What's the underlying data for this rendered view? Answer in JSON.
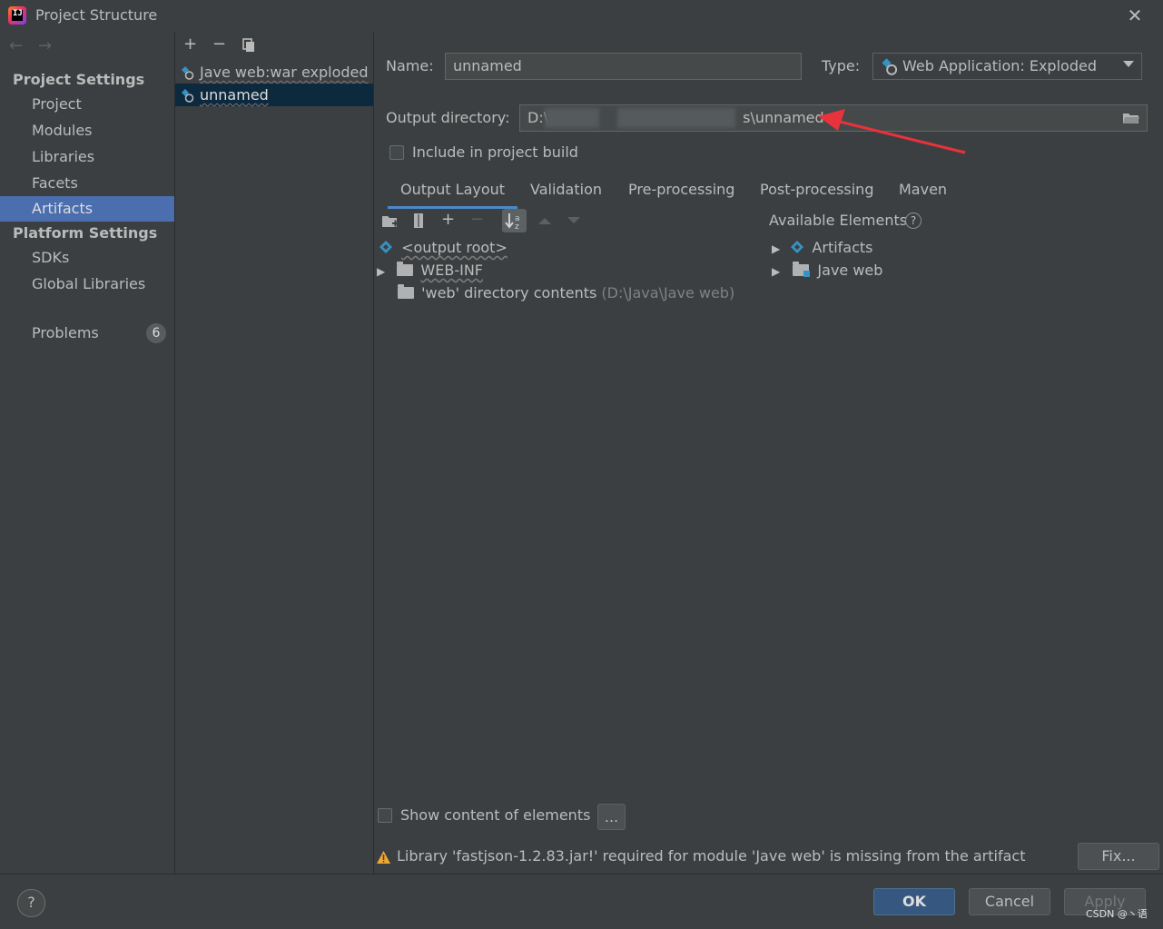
{
  "window": {
    "title": "Project Structure"
  },
  "nav": {
    "project_settings_header": "Project Settings",
    "items_project": [
      "Project",
      "Modules",
      "Libraries",
      "Facets",
      "Artifacts"
    ],
    "platform_settings_header": "Platform Settings",
    "items_platform": [
      "SDKs",
      "Global Libraries"
    ],
    "problems_label": "Problems",
    "problems_count": "6",
    "selected": "Artifacts"
  },
  "artifacts": {
    "items": [
      "Jave web:war exploded",
      "unnamed"
    ],
    "selected": "unnamed"
  },
  "detail": {
    "name_label": "Name:",
    "name_value": "unnamed",
    "type_label": "Type:",
    "type_value": "Web Application: Exploded",
    "output_dir_label": "Output directory:",
    "output_dir_prefix": "D:\\",
    "output_dir_suffix": "s\\unnamed",
    "include_build_label": "Include in project build",
    "include_build_checked": false,
    "tabs": [
      "Output Layout",
      "Validation",
      "Pre-processing",
      "Post-processing",
      "Maven"
    ],
    "active_tab": "Output Layout"
  },
  "output_layout": {
    "tree": [
      {
        "label": "<output root>",
        "icon": "artifact-root-icon",
        "expandable": false
      },
      {
        "label": "WEB-INF",
        "icon": "folder-icon",
        "expandable": true
      },
      {
        "label": "'web' directory contents",
        "path": "(D:\\Java\\Jave web)",
        "icon": "folder-icon",
        "expandable": false
      }
    ]
  },
  "available": {
    "header": "Available Elements",
    "items": [
      {
        "label": "Artifacts",
        "icon": "artifacts-icon"
      },
      {
        "label": "Jave web",
        "icon": "module-folder-icon"
      }
    ]
  },
  "bottom": {
    "show_content_label": "Show content of elements",
    "more_button": "...",
    "warning_text": "Library 'fastjson-1.2.83.jar!' required for module 'Jave web' is missing from the artifact",
    "fix_button": "Fix..."
  },
  "footer": {
    "help": "?",
    "ok": "OK",
    "cancel": "Cancel",
    "apply": "Apply",
    "watermark": "CSDN @丶语"
  },
  "colors": {
    "background": "#3c3f41",
    "selection": "#4b6eaf",
    "list_selection": "#0d293e",
    "ok_button": "#365880",
    "annotation_arrow": "#e8323c"
  }
}
